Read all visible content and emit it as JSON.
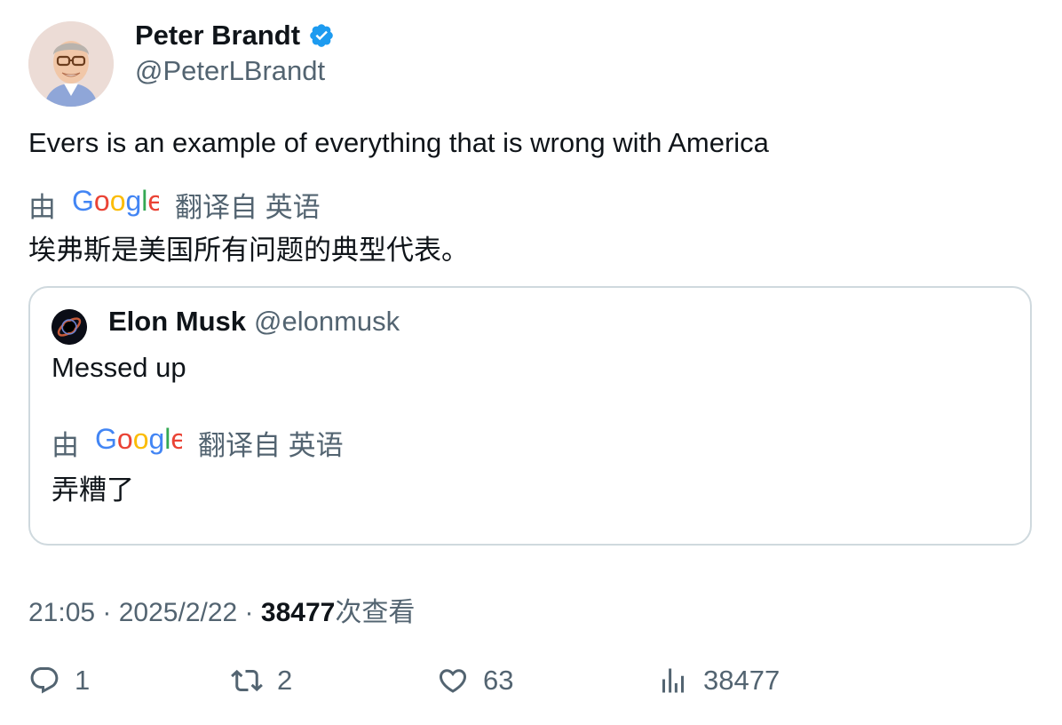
{
  "author": {
    "name": "Peter Brandt",
    "handle": "@PeterLBrandt",
    "verified_icon": "verified-badge-icon"
  },
  "tweet": {
    "text": "Evers is an example of everything that is wrong with America",
    "translation": {
      "by_label": "由",
      "provider": "Google",
      "from_label": "翻译自 英语",
      "text": "埃弗斯是美国所有问题的典型代表。"
    }
  },
  "quote": {
    "name": "Elon Musk",
    "handle": "@elonmusk",
    "text": "Messed up",
    "translation": {
      "by_label": "由",
      "provider": "Google",
      "from_label": "翻译自 英语",
      "text": "弄糟了"
    }
  },
  "meta": {
    "time": "21:05",
    "sep1": " · ",
    "date": "2025/2/22",
    "sep2": " · ",
    "views_count": "38477",
    "views_label": "次查看"
  },
  "actions": {
    "reply": {
      "icon": "reply-icon",
      "count": "1"
    },
    "retweet": {
      "icon": "retweet-icon",
      "count": "2"
    },
    "like": {
      "icon": "heart-icon",
      "count": "63"
    },
    "views": {
      "icon": "analytics-icon",
      "count": "38477"
    }
  },
  "colors": {
    "text": "#0f1419",
    "secondary": "#536471",
    "border": "#cfd9de",
    "verified": "#1d9bf0",
    "google_blue": "#4285F4",
    "google_red": "#EA4335",
    "google_yellow": "#FBBC05",
    "google_green": "#34A853"
  }
}
